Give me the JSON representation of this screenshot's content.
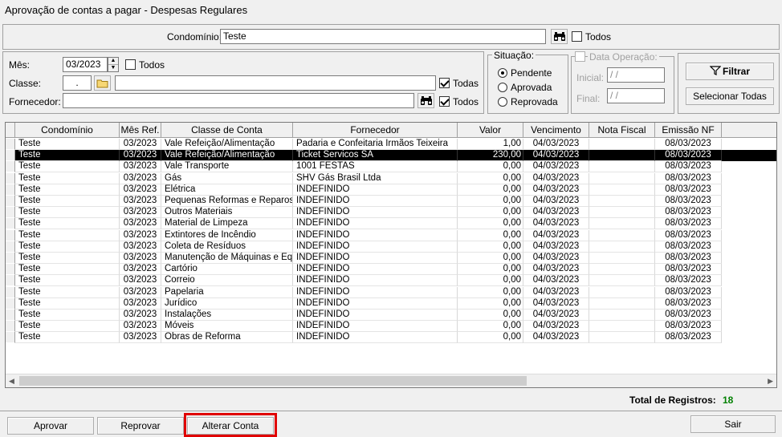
{
  "window": {
    "title": "Aprovação de contas a pagar - Despesas Regulares"
  },
  "filters": {
    "condominio_label": "Condomínio:",
    "condominio_value": "Teste",
    "condominio_todos": "Todos",
    "mes_label": "Mês:",
    "mes_value": "03/2023",
    "mes_todos": "Todos",
    "classe_label": "Classe:",
    "classe_code": ".",
    "classe_name": "",
    "classe_todas": "Todas",
    "fornecedor_label": "Fornecedor:",
    "fornecedor_value": "",
    "fornecedor_todos": "Todos"
  },
  "situacao": {
    "title": "Situação:",
    "options": [
      "Pendente",
      "Aprovada",
      "Reprovada"
    ],
    "selected": "Pendente"
  },
  "data_operacao": {
    "title": "Data Operação:",
    "inicial_label": "Inicial:",
    "inicial_value": " / /",
    "final_label": "Final:",
    "final_value": " / /"
  },
  "actions": {
    "filtrar": "Filtrar",
    "selecionar_todas": "Selecionar Todas"
  },
  "grid": {
    "columns": [
      "Condomínio",
      "Mês Ref.",
      "Classe de Conta",
      "Fornecedor",
      "Valor",
      "Vencimento",
      "Nota Fiscal",
      "Emissão NF"
    ],
    "rows": [
      [
        "Teste",
        "03/2023",
        "Vale Refeição/Alimentação",
        "Padaria e Confeitaria Irmãos Teixeira",
        "1,00",
        "04/03/2023",
        "",
        "08/03/2023"
      ],
      [
        "Teste",
        "03/2023",
        "Vale Refeição/Alimentação",
        "Ticket Servicos SA",
        "230,00",
        "04/03/2023",
        "",
        "08/03/2023"
      ],
      [
        "Teste",
        "03/2023",
        "Vale Transporte",
        "1001 FESTAS",
        "0,00",
        "04/03/2023",
        "",
        "08/03/2023"
      ],
      [
        "Teste",
        "03/2023",
        "Gás",
        "SHV Gás Brasil Ltda",
        "0,00",
        "04/03/2023",
        "",
        "08/03/2023"
      ],
      [
        "Teste",
        "03/2023",
        "Elétrica",
        "INDEFINIDO",
        "0,00",
        "04/03/2023",
        "",
        "08/03/2023"
      ],
      [
        "Teste",
        "03/2023",
        "Pequenas Reformas e Reparos",
        "INDEFINIDO",
        "0,00",
        "04/03/2023",
        "",
        "08/03/2023"
      ],
      [
        "Teste",
        "03/2023",
        "Outros Materiais",
        "INDEFINIDO",
        "0,00",
        "04/03/2023",
        "",
        "08/03/2023"
      ],
      [
        "Teste",
        "03/2023",
        "Material de Limpeza",
        "INDEFINIDO",
        "0,00",
        "04/03/2023",
        "",
        "08/03/2023"
      ],
      [
        "Teste",
        "03/2023",
        "Extintores de Incêndio",
        "INDEFINIDO",
        "0,00",
        "04/03/2023",
        "",
        "08/03/2023"
      ],
      [
        "Teste",
        "03/2023",
        "Coleta de Resíduos",
        "INDEFINIDO",
        "0,00",
        "04/03/2023",
        "",
        "08/03/2023"
      ],
      [
        "Teste",
        "03/2023",
        "Manutenção de Máquinas e Equi",
        "INDEFINIDO",
        "0,00",
        "04/03/2023",
        "",
        "08/03/2023"
      ],
      [
        "Teste",
        "03/2023",
        "Cartório",
        "INDEFINIDO",
        "0,00",
        "04/03/2023",
        "",
        "08/03/2023"
      ],
      [
        "Teste",
        "03/2023",
        "Correio",
        "INDEFINIDO",
        "0,00",
        "04/03/2023",
        "",
        "08/03/2023"
      ],
      [
        "Teste",
        "03/2023",
        "Papelaria",
        "INDEFINIDO",
        "0,00",
        "04/03/2023",
        "",
        "08/03/2023"
      ],
      [
        "Teste",
        "03/2023",
        "Jurídico",
        "INDEFINIDO",
        "0,00",
        "04/03/2023",
        "",
        "08/03/2023"
      ],
      [
        "Teste",
        "03/2023",
        "Instalações",
        "INDEFINIDO",
        "0,00",
        "04/03/2023",
        "",
        "08/03/2023"
      ],
      [
        "Teste",
        "03/2023",
        "Móveis",
        "INDEFINIDO",
        "0,00",
        "04/03/2023",
        "",
        "08/03/2023"
      ],
      [
        "Teste",
        "03/2023",
        "Obras de Reforma",
        "INDEFINIDO",
        "0,00",
        "04/03/2023",
        "",
        "08/03/2023"
      ]
    ],
    "selected_row": 1
  },
  "footer": {
    "total_label": "Total de Registros:",
    "total_value": "18",
    "total_color": "#008000",
    "aprovar": "Aprovar",
    "reprovar": "Reprovar",
    "alterar_conta": "Alterar Conta",
    "sair": "Sair",
    "highlight_color": "#e00000"
  }
}
